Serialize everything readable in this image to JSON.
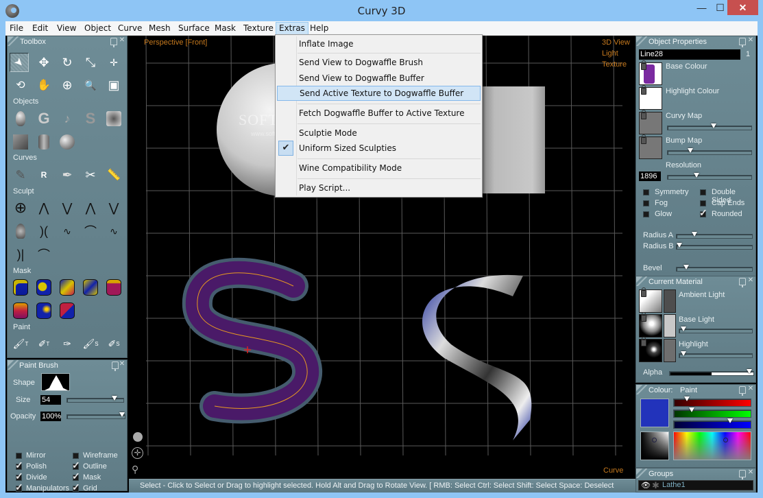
{
  "window": {
    "title": "Curvy 3D",
    "minimize_glyph": "—",
    "maximize_glyph": "☐",
    "close_glyph": "✕"
  },
  "menubar": {
    "items": [
      "File",
      "Edit",
      "View",
      "Object",
      "Curve",
      "Mesh",
      "Surface",
      "Mask",
      "Texture",
      "Extras",
      "Help"
    ],
    "active": "Extras"
  },
  "extras_menu": {
    "items": [
      {
        "label": "Inflate Image",
        "checked": false,
        "highlighted": false
      },
      {
        "label": "Send View to Dogwaffle Brush",
        "checked": false,
        "highlighted": false
      },
      {
        "label": "Send View to Dogwaffle Buffer",
        "checked": false,
        "highlighted": false
      },
      {
        "label": "Send Active Texture to Dogwaffle Buffer",
        "checked": false,
        "highlighted": true
      },
      {
        "label": "Fetch Dogwaffle Buffer to Active Texture",
        "checked": false,
        "highlighted": false
      },
      {
        "label": "Sculptie Mode",
        "checked": false,
        "highlighted": false
      },
      {
        "label": "Uniform Sized Sculpties",
        "checked": true,
        "highlighted": false
      },
      {
        "label": "Wine Compatibility Mode",
        "checked": false,
        "highlighted": false
      },
      {
        "label": "Play Script...",
        "checked": false,
        "highlighted": false
      }
    ],
    "check_glyph": "✔"
  },
  "toolbox": {
    "title": "Toolbox",
    "sections": {
      "objects": "Objects",
      "curves": "Curves",
      "sculpt": "Sculpt",
      "mask": "Mask",
      "paint": "Paint"
    },
    "tool_glyphs": {
      "select": "➤",
      "move": "✥",
      "rotate": "↻",
      "scale": "⤡",
      "transform": "✛",
      "swap": "⟲",
      "pan": "✋",
      "target": "⊕",
      "zoom": "🔍",
      "page": "▣",
      "curve_s": "S",
      "curve_r": "R",
      "paint_t": "T",
      "paint_s": "S"
    }
  },
  "paint_brush": {
    "title": "Paint Brush",
    "shape_label": "Shape",
    "size_label": "Size",
    "size_value": "54",
    "size_fraction": 0.88,
    "opacity_label": "Opacity",
    "opacity_value": "100%",
    "opacity_fraction": 1.0,
    "options": [
      {
        "label": "Mirror",
        "checked": false
      },
      {
        "label": "Wireframe",
        "checked": false
      },
      {
        "label": "Polish",
        "checked": true
      },
      {
        "label": "Outline",
        "checked": true
      },
      {
        "label": "Divide",
        "checked": true
      },
      {
        "label": "Mask",
        "checked": true
      },
      {
        "label": "Manipulators",
        "checked": true
      },
      {
        "label": "Grid",
        "checked": true
      }
    ]
  },
  "viewport": {
    "view_name": "Perspective [Front]",
    "modes": [
      "3D View",
      "Light",
      "Texture"
    ],
    "mode_bottom": "Curve",
    "watermark": "SOFTPEDIA",
    "watermark_url": "www.softpedia.com"
  },
  "status": {
    "text": "Select - Click to Select or Drag to highlight selected. Hold Alt and Drag to Rotate View. [ RMB: Select   Ctrl: Select   Shift: Select   Space: Deselect"
  },
  "object_properties": {
    "title": "Object Properties",
    "name": "Line28",
    "count": "1",
    "base_colour": "Base Colour",
    "highlight_colour": "Highlight Colour",
    "curvy_map": "Curvy Map",
    "curvy_map_fraction": 0.55,
    "bump_map": "Bump Map",
    "bump_map_fraction": 0.25,
    "resolution_label": "Resolution",
    "resolution_value": "1896",
    "resolution_fraction": 0.33,
    "flags": [
      {
        "label": "Symmetry",
        "checked": false
      },
      {
        "label": "Double Sided",
        "checked": false
      },
      {
        "label": "Fog",
        "checked": false
      },
      {
        "label": "Cap Ends",
        "checked": false
      },
      {
        "label": "Glow",
        "checked": false
      },
      {
        "label": "Rounded",
        "checked": true
      }
    ],
    "radius_a_label": "Radius A",
    "radius_a_fraction": 0.22,
    "radius_b_label": "Radius B",
    "radius_b_fraction": 0.0,
    "bevel_label": "Bevel",
    "bevel_fraction": 0.1
  },
  "current_material": {
    "title": "Current Material",
    "ambient": "Ambient Light",
    "base_light": "Base Light",
    "base_light_fraction": 0.02,
    "highlight": "Highlight",
    "highlight_fraction": 0.02,
    "alpha_label": "Alpha",
    "alpha_fraction": 0.98
  },
  "colour": {
    "title": "Colour:",
    "mode": "Paint",
    "current_hex": "#2233bb",
    "red_fraction": 0.14,
    "green_fraction": 0.21,
    "blue_fraction": 0.75
  },
  "groups": {
    "title": "Groups",
    "items": [
      {
        "name": "Lathe1",
        "visible": true
      }
    ]
  }
}
